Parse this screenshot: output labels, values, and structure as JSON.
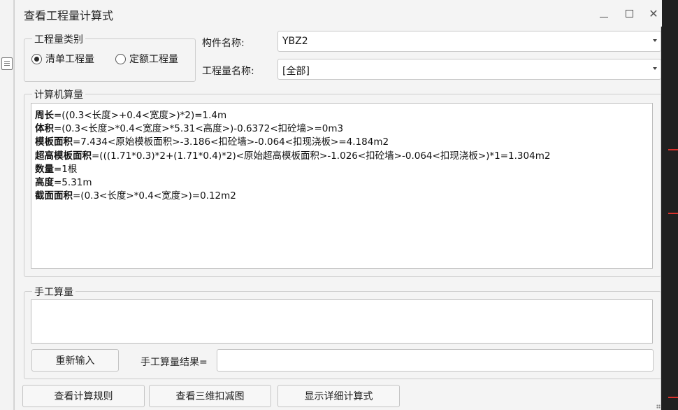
{
  "window": {
    "title": "查看工程量计算式"
  },
  "quantity_type": {
    "legend": "工程量类别",
    "options": [
      {
        "label": "清单工程量",
        "checked": true
      },
      {
        "label": "定额工程量",
        "checked": false
      }
    ]
  },
  "component": {
    "label": "构件名称:",
    "value": "YBZ2"
  },
  "quantity_name": {
    "label": "工程量名称:",
    "value": "[全部]"
  },
  "computer_calc": {
    "legend": "计算机算量",
    "lines": [
      {
        "name": "周长",
        "expr": "=((0.3<长度>+0.4<宽度>)*2)=1.4m"
      },
      {
        "name": "体积",
        "expr": "=(0.3<长度>*0.4<宽度>*5.31<高度>)-0.6372<扣砼墙>=0m3"
      },
      {
        "name": "模板面积",
        "expr": "=7.434<原始模板面积>-3.186<扣砼墙>-0.064<扣现浇板>=4.184m2"
      },
      {
        "name": "超高模板面积",
        "expr": "=(((1.71*0.3)*2+(1.71*0.4)*2)<原始超高模板面积>-1.026<扣砼墙>-0.064<扣现浇板>)*1=1.304m2"
      },
      {
        "name": "数量",
        "expr": "=1根"
      },
      {
        "name": "高度",
        "expr": "=5.31m"
      },
      {
        "name": "截面面积",
        "expr": "=(0.3<长度>*0.4<宽度>)=0.12m2"
      }
    ]
  },
  "manual_calc": {
    "legend": "手工算量",
    "reinput_label": "重新输入",
    "result_label": "手工算量结果=",
    "result_value": ""
  },
  "footer": {
    "view_rules": "查看计算规则",
    "view_3d": "查看三维扣减图",
    "show_detail": "显示详细计算式"
  },
  "colors": {
    "background_accent": "#d9312b"
  }
}
